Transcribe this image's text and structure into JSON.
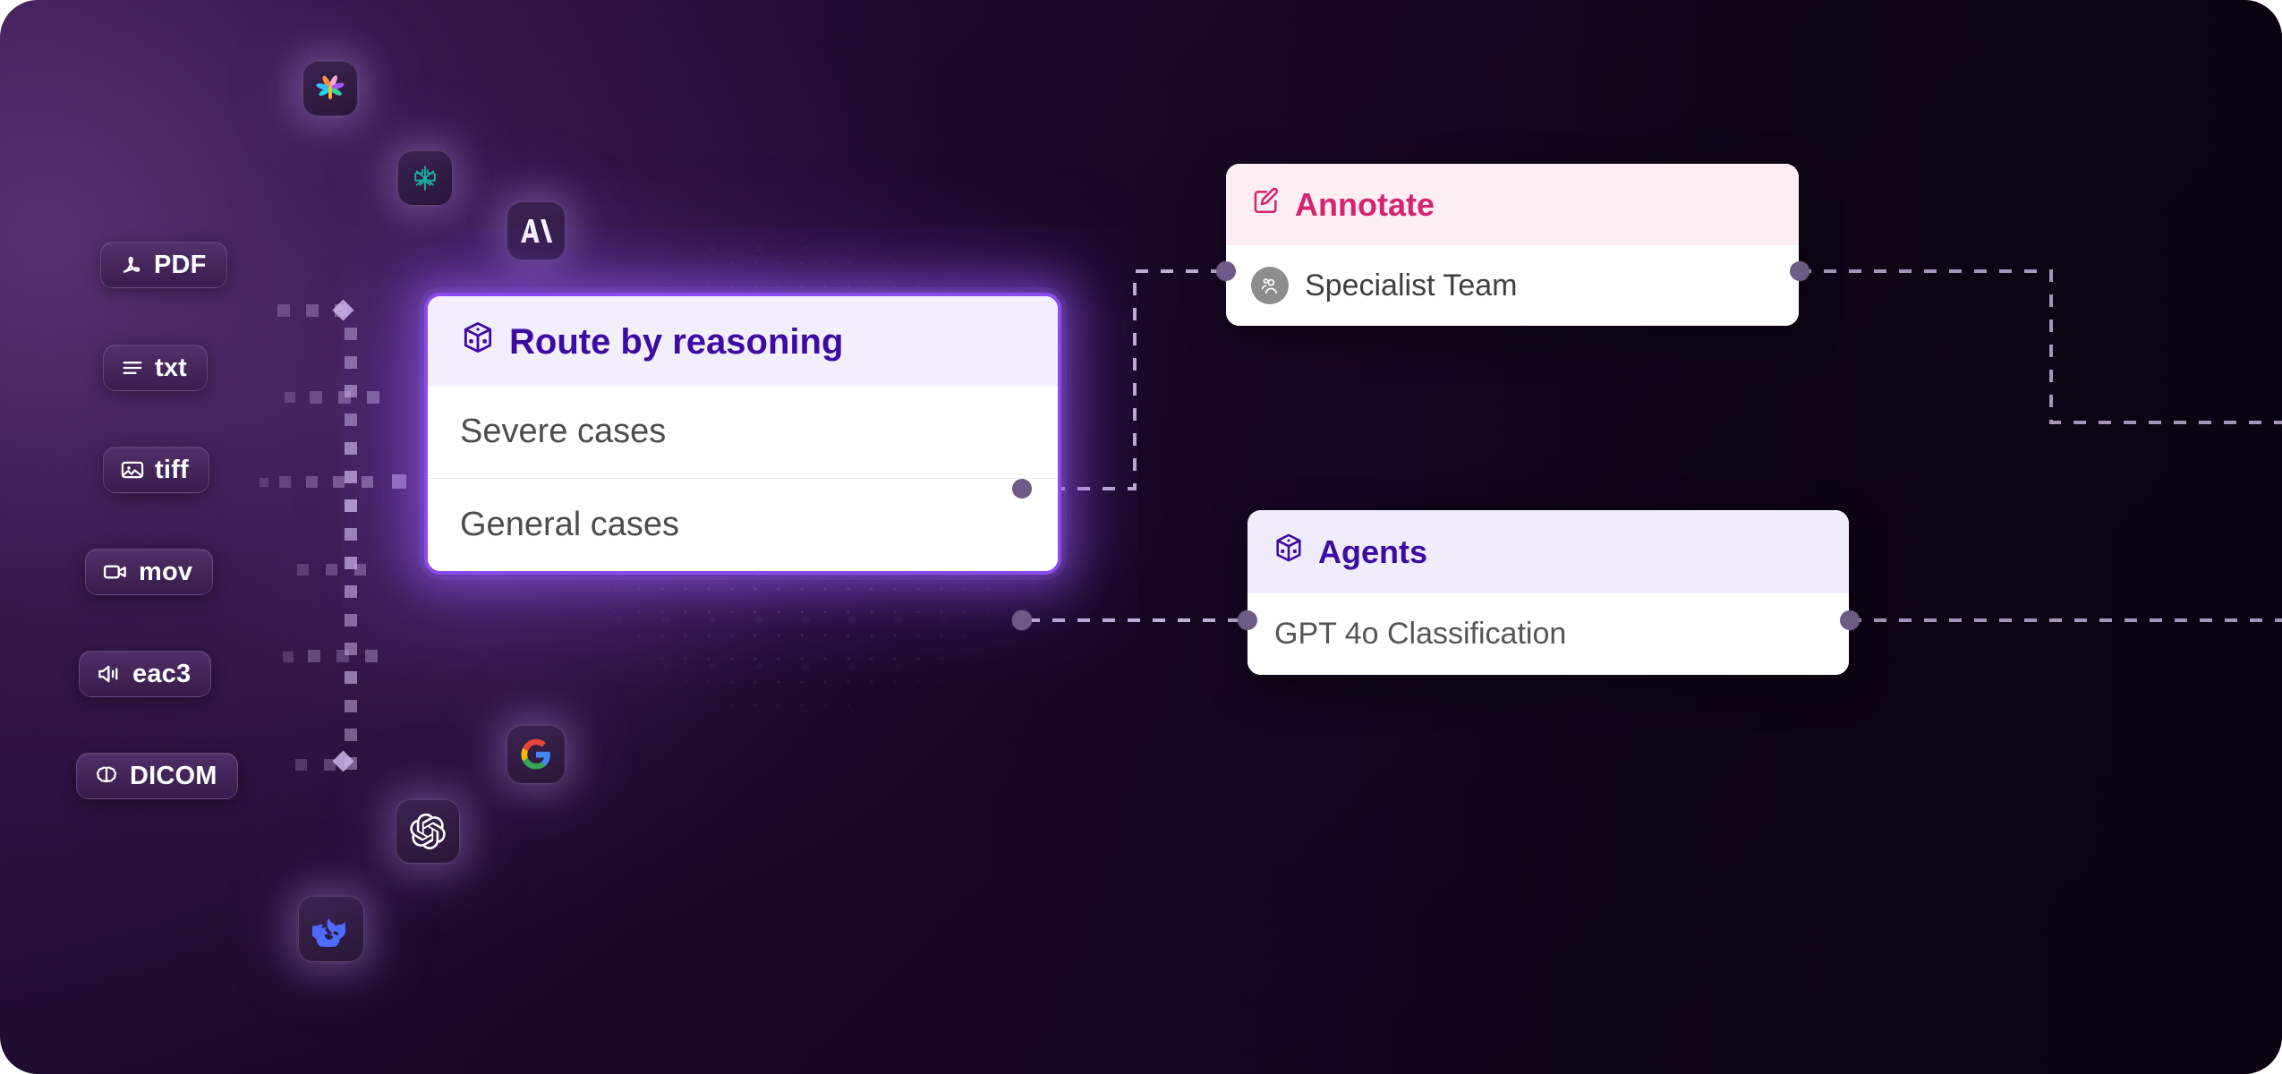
{
  "theme": {
    "accent_purple": "#8B4BEC",
    "deep_purple_text": "#3A0CA3",
    "pink_accent": "#D4246E",
    "annotate_header_bg": "#FCEEF3",
    "agents_header_bg": "#F1ECFB",
    "route_header_bg": "#F3EEFC",
    "canvas_dark": "#190725",
    "connector_dash": "#D8C6EE"
  },
  "file_chips": [
    {
      "label": "PDF",
      "icon": "pdf-icon"
    },
    {
      "label": "txt",
      "icon": "text-lines-icon"
    },
    {
      "label": "tiff",
      "icon": "image-icon"
    },
    {
      "label": "mov",
      "icon": "video-camera-icon"
    },
    {
      "label": "eac3",
      "icon": "speaker-icon"
    },
    {
      "label": "DICOM",
      "icon": "brain-icon"
    }
  ],
  "model_badges": [
    {
      "name": "palm-logo",
      "title": "PaLM"
    },
    {
      "name": "mistral-logo",
      "title": "Mistral"
    },
    {
      "name": "anthropic-logo",
      "title": "Anthropic"
    },
    {
      "name": "google-logo",
      "title": "Google"
    },
    {
      "name": "openai-logo",
      "title": "OpenAI"
    },
    {
      "name": "deepseek-logo",
      "title": "DeepSeek"
    }
  ],
  "route_card": {
    "title": "Route by reasoning",
    "icon": "cube-icon",
    "rows": [
      {
        "label": "Severe cases"
      },
      {
        "label": "General cases"
      }
    ]
  },
  "annotate_card": {
    "title": "Annotate",
    "icon": "pencil-square-icon",
    "rows": [
      {
        "label": "Specialist Team",
        "icon": "users-avatar-icon"
      }
    ]
  },
  "agents_card": {
    "title": "Agents",
    "icon": "cube-icon",
    "rows": [
      {
        "label": "GPT 4o Classification"
      }
    ]
  }
}
